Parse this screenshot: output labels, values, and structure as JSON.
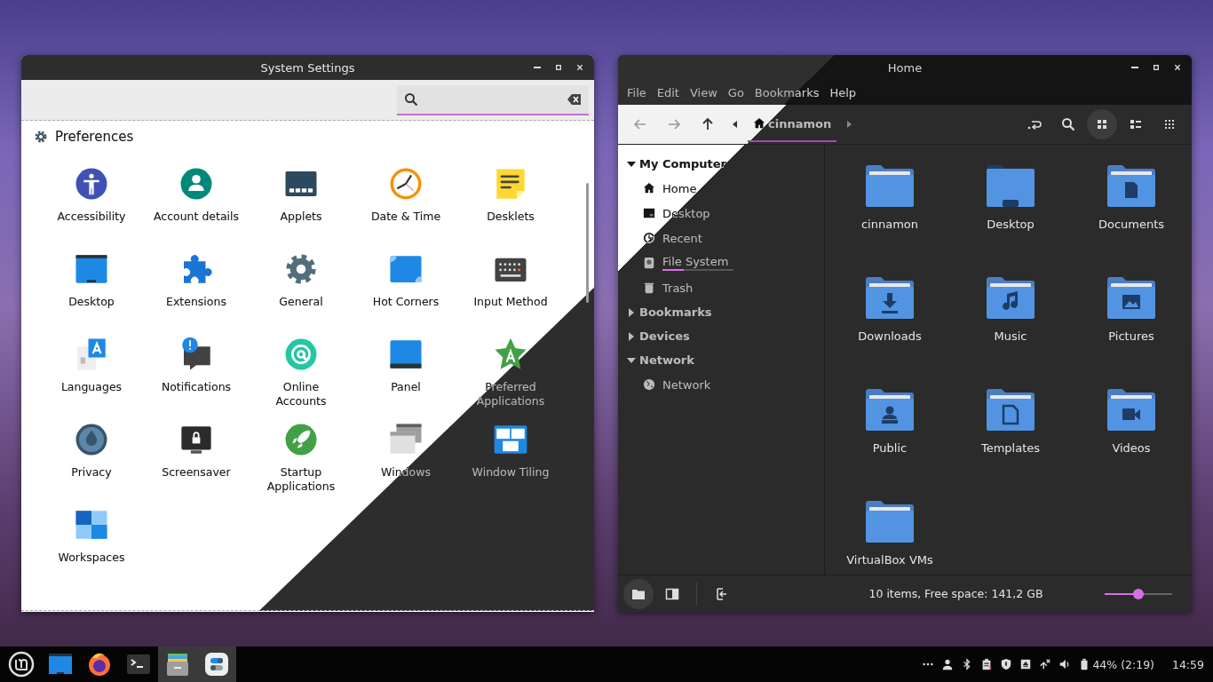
{
  "settings_window": {
    "title": "System Settings",
    "section": "Preferences",
    "items": [
      {
        "label": "Accessibility"
      },
      {
        "label": "Account details"
      },
      {
        "label": "Applets"
      },
      {
        "label": "Date & Time"
      },
      {
        "label": "Desklets"
      },
      {
        "label": "Desktop"
      },
      {
        "label": "Extensions"
      },
      {
        "label": "General"
      },
      {
        "label": "Hot Corners"
      },
      {
        "label": "Input Method"
      },
      {
        "label": "Languages"
      },
      {
        "label": "Notifications"
      },
      {
        "label": "Online\nAccounts"
      },
      {
        "label": "Panel"
      },
      {
        "label": "Preferred\nApplications"
      },
      {
        "label": "Privacy"
      },
      {
        "label": "Screensaver"
      },
      {
        "label": "Startup\nApplications"
      },
      {
        "label": "Windows"
      },
      {
        "label": "Window Tiling"
      },
      {
        "label": "Workspaces"
      }
    ]
  },
  "file_manager": {
    "title": "Home",
    "menu": [
      "File",
      "Edit",
      "View",
      "Go",
      "Bookmarks",
      "Help"
    ],
    "path": "cinnamon",
    "view_modes": [
      {
        "selected": true
      },
      {
        "selected": false
      },
      {
        "selected": false
      }
    ],
    "sidebar": [
      {
        "label": "My Computer",
        "expanded": true,
        "children": [
          {
            "label": "Home"
          },
          {
            "label": "Desktop"
          },
          {
            "label": "Recent"
          },
          {
            "label": "File System",
            "level": 0.3
          },
          {
            "label": "Trash"
          }
        ]
      },
      {
        "label": "Bookmarks",
        "expanded": false
      },
      {
        "label": "Devices",
        "expanded": false
      },
      {
        "label": "Network",
        "expanded": true,
        "children": [
          {
            "label": "Network"
          }
        ]
      }
    ],
    "files": [
      {
        "name": "cinnamon"
      },
      {
        "name": "Desktop"
      },
      {
        "name": "Documents"
      },
      {
        "name": "Downloads"
      },
      {
        "name": "Music"
      },
      {
        "name": "Pictures"
      },
      {
        "name": "Public"
      },
      {
        "name": "Templates"
      },
      {
        "name": "Videos"
      },
      {
        "name": "VirtualBox VMs"
      }
    ],
    "bottom_buttons": [
      {
        "selected": true
      },
      {
        "selected": false
      }
    ],
    "status": "10 items, Free space: 141,2 GB",
    "zoom": {
      "level": 0.5
    }
  },
  "taskbar": {
    "apps": [
      {
        "selected": false
      },
      {
        "selected": false
      },
      {
        "selected": false
      },
      {
        "selected": false
      },
      {
        "selected": true
      },
      {
        "selected": true
      }
    ],
    "battery": "44% (2:19)",
    "clock": "14:59"
  }
}
